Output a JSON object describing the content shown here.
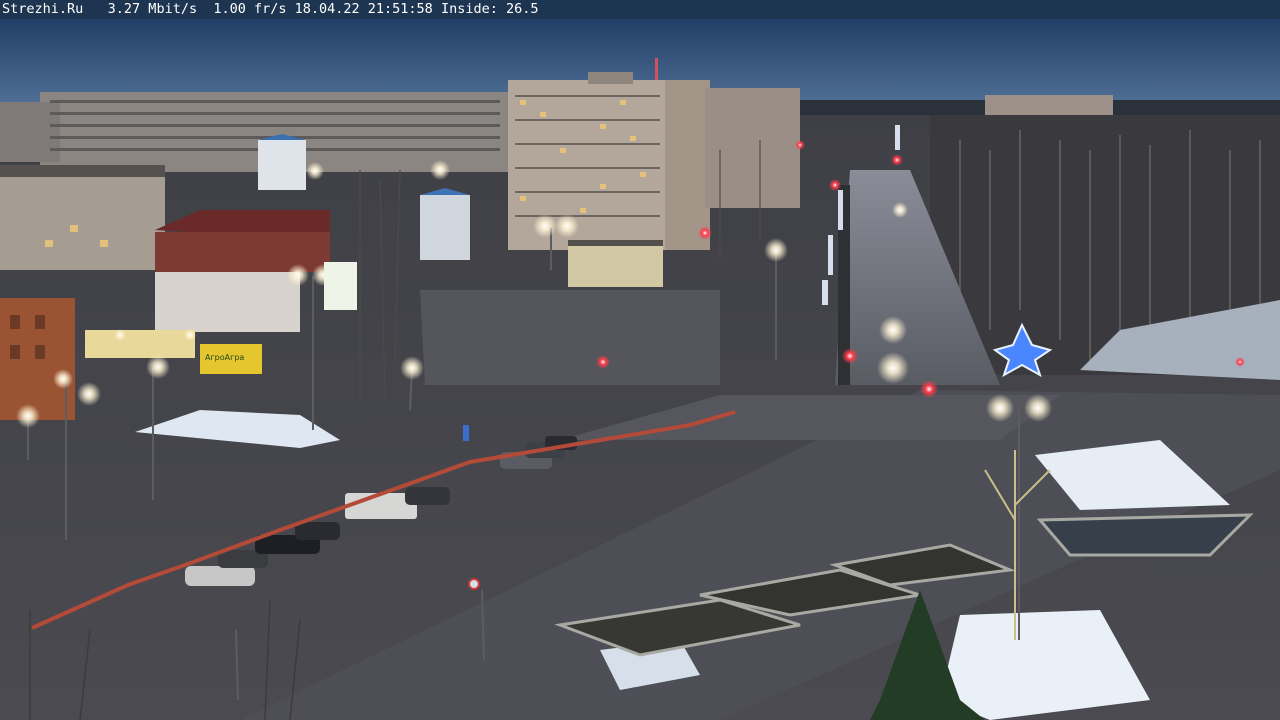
{
  "overlay": {
    "site": "Strezhi.Ru",
    "bitrate": "3.27 Mbit/s",
    "framerate": "1.00 fr/s",
    "datetime": "18.04.22 21:51:58",
    "inside": "Inside: 26.5"
  },
  "storefront_sign": "АгроАгра",
  "colors": {
    "sky_top": "#27466f",
    "sky_bottom": "#4f6f98",
    "ground": "#45464c",
    "road": "#4d4e55",
    "street_light": "#fff6dc",
    "snow": "#dfe8f2",
    "overlay_bg": "#1e3551"
  }
}
